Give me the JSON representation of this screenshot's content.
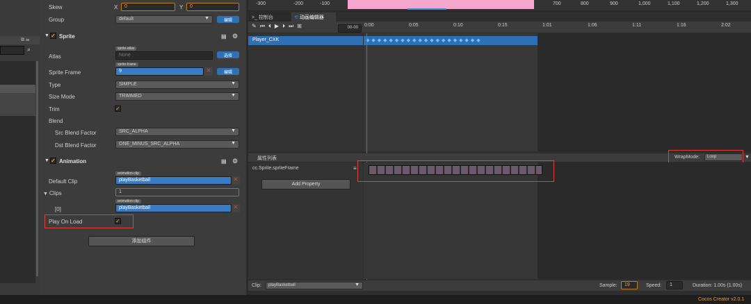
{
  "top_ruler": {
    "ticks": [
      "-300",
      "-200",
      "-100",
      "700",
      "800",
      "900",
      "1,000",
      "1,100",
      "1,200",
      "1,300"
    ]
  },
  "left_panel": {
    "search_icon": "search-icon"
  },
  "inspector": {
    "skew": {
      "label": "Skew",
      "x_label": "X",
      "x_value": "0",
      "y_label": "Y",
      "y_value": "0"
    },
    "group": {
      "label": "Group",
      "value": "default",
      "edit_label": "编辑"
    },
    "sprite": {
      "title": "Sprite",
      "atlas": {
        "label": "Atlas",
        "tag": "sprite-atlas",
        "value": "None",
        "button": "选择"
      },
      "sprite_frame": {
        "label": "Sprite Frame",
        "tag": "sprite-frame",
        "value": "9",
        "button": "编辑"
      },
      "type": {
        "label": "Type",
        "value": "SIMPLE"
      },
      "size_mode": {
        "label": "Size Mode",
        "value": "TRIMMED"
      },
      "trim": {
        "label": "Trim"
      },
      "blend": {
        "label": "Blend"
      },
      "src_blend": {
        "label": "Src Blend Factor",
        "value": "SRC_ALPHA"
      },
      "dst_blend": {
        "label": "Dst Blend Factor",
        "value": "ONE_MINUS_SRC_ALPHA"
      }
    },
    "animation": {
      "title": "Animation",
      "default_clip": {
        "label": "Default Clip",
        "tag": "animation-clip",
        "value": "playBasketball"
      },
      "clips": {
        "label": "Clips",
        "count": "1"
      },
      "clip0": {
        "label": "[0]",
        "tag": "animation-clip",
        "value": "playBasketball"
      },
      "play_on_load": {
        "label": "Play On Load"
      }
    },
    "add_component": "添加组件"
  },
  "anim_editor": {
    "tabs": [
      {
        "label": "控制台"
      },
      {
        "label": "动画编辑器"
      }
    ],
    "time_field": "00-00",
    "time_ticks": [
      "0:00",
      "0:05",
      "0:10",
      "0:15",
      "1:01",
      "1:06",
      "1:11",
      "1:16",
      "2:02"
    ],
    "node_name": "Player_CXK",
    "property_list_title": "属性列表",
    "wrap_mode_label": "WrapMode:",
    "wrap_mode_value": "Loop",
    "property_name": "cc.Sprite.spriteFrame",
    "add_property": "Add Property",
    "clip_label": "Clip:",
    "clip_value": "playBasketball",
    "sample_label": "Sample:",
    "sample_value": "19",
    "speed_label": "Speed:",
    "speed_value": "1",
    "duration": "Duration: 1.00s (1.00s)"
  },
  "status_bar": {
    "version": "Cocos Creator v2.0.1"
  },
  "colors": {
    "accent_blue": "#2f6fb3",
    "highlight_red": "#e04040",
    "status_orange": "#f0a030",
    "scene_pink": "#f4a6cc"
  }
}
